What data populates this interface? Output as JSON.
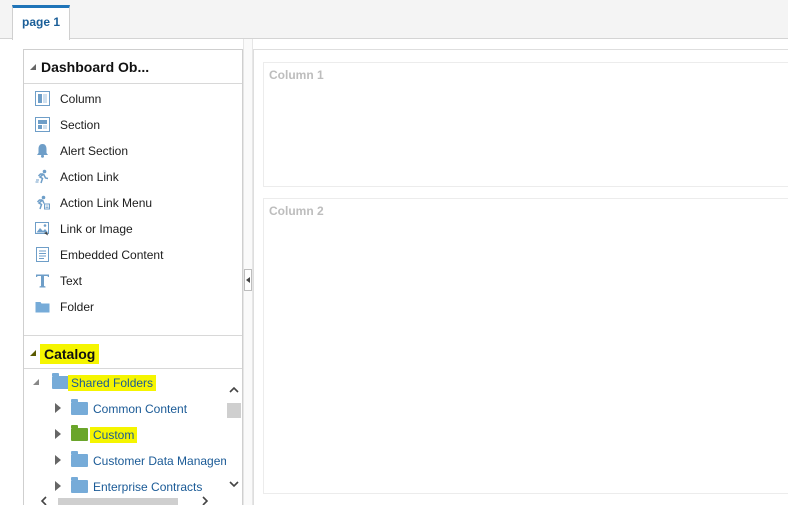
{
  "tabs": [
    {
      "label": "page 1",
      "active": true
    }
  ],
  "dashboard_objects": {
    "title": "Dashboard Ob...",
    "items": [
      {
        "label": "Column",
        "icon": "column-icon"
      },
      {
        "label": "Section",
        "icon": "section-icon"
      },
      {
        "label": "Alert Section",
        "icon": "bell-icon"
      },
      {
        "label": "Action Link",
        "icon": "action-link-icon"
      },
      {
        "label": "Action Link Menu",
        "icon": "action-link-menu-icon"
      },
      {
        "label": "Link or Image",
        "icon": "link-image-icon"
      },
      {
        "label": "Embedded Content",
        "icon": "embedded-content-icon"
      },
      {
        "label": "Text",
        "icon": "text-icon"
      },
      {
        "label": "Folder",
        "icon": "folder-icon"
      }
    ]
  },
  "catalog": {
    "title": "Catalog",
    "highlight_color": "#f5f500",
    "tree": [
      {
        "label": "Shared Folders",
        "level": 0,
        "expanded": true,
        "highlighted": true
      },
      {
        "label": "Common Content",
        "level": 1,
        "expanded": false,
        "highlighted": false
      },
      {
        "label": "Custom",
        "level": 1,
        "expanded": false,
        "highlighted": true
      },
      {
        "label": "Customer Data Managem",
        "level": 1,
        "expanded": false,
        "highlighted": false
      },
      {
        "label": "Enterprise Contracts",
        "level": 1,
        "expanded": false,
        "highlighted": false
      }
    ]
  },
  "canvas": {
    "columns": [
      {
        "label": "Column 1"
      },
      {
        "label": "Column 2"
      }
    ]
  },
  "colors": {
    "accent": "#1f74b8",
    "link": "#1a5a96",
    "folder": "#76abd8",
    "highlight": "#f5f500"
  }
}
